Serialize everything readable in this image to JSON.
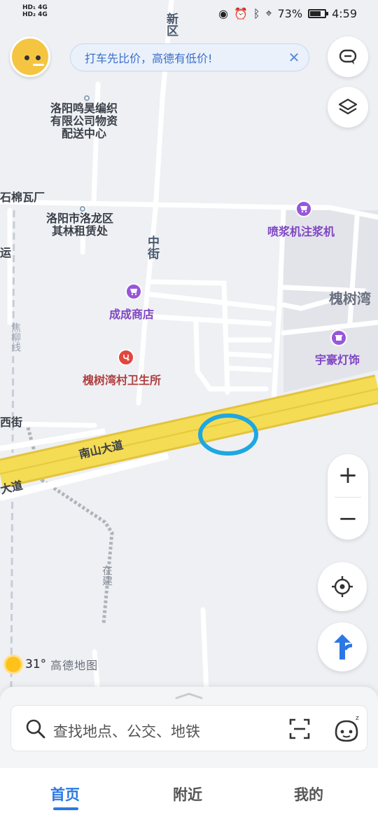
{
  "status_bar": {
    "network_left_top": "HD₁ 4G",
    "network_left_bottom": "HD₂ 4G",
    "battery": "73%",
    "battery_level": 0.73,
    "time": "4:59"
  },
  "banner": {
    "text": "打车先比价，高德有低价!"
  },
  "map": {
    "places": {
      "minghao": "洛阳鸣昊编织\n有限公司物资\n配送中心",
      "luolong": "洛阳市洛龙区\n其林租赁处",
      "shimianwa": "石棉瓦厂",
      "yun": "运",
      "xiejie": "西街",
      "huaishuwan": "槐树湾"
    },
    "pois": {
      "penjiang": "喷浆机注浆机",
      "chengcheng": "成成商店",
      "yuhao": "宇豪灯饰",
      "clinic": "槐树湾村卫生所"
    },
    "roads": {
      "xinqu": "新区",
      "zhongjie": "中街",
      "jiaoliu": "焦柳线",
      "nanshan1": "南山大道",
      "nanshan2": "大道",
      "zaijian": "在建"
    }
  },
  "weather": {
    "temp": "31°",
    "brand": "高德地图"
  },
  "search": {
    "placeholder": "查找地点、公交、地铁"
  },
  "tabs": [
    {
      "label": "首页",
      "active": true
    },
    {
      "label": "附近",
      "active": false
    },
    {
      "label": "我的",
      "active": false
    }
  ],
  "colors": {
    "accent": "#2b78e4",
    "highway": "#f2d94a",
    "highlight_circle": "#1ea7e1",
    "poi_purple": "#9856da",
    "poi_red": "#e2463d"
  }
}
